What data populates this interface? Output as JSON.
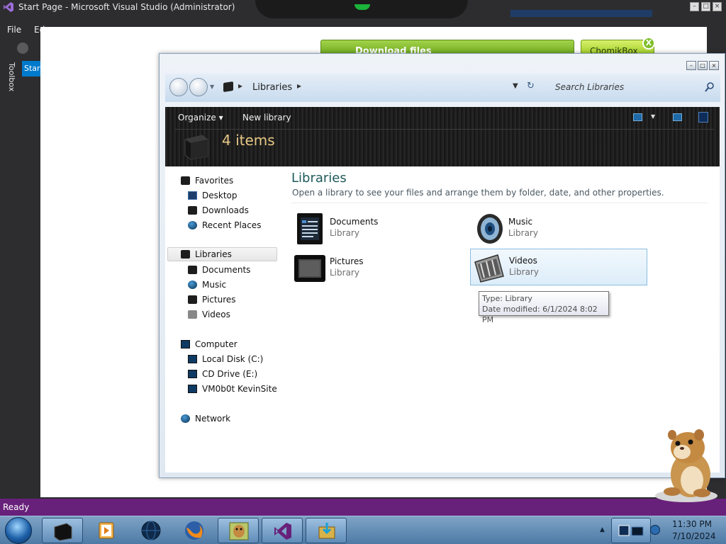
{
  "vs": {
    "title": "Start Page - Microsoft Visual Studio (Administrator)",
    "menu": {
      "file": "File",
      "edit": "Ed"
    },
    "toolbox_label": "Toolbox",
    "start_tab": "Start",
    "status": "Ready",
    "accent_color": "#68217a"
  },
  "ad": {
    "download_label": "Download files",
    "brand_label": "ChomikBox",
    "close_label": "X"
  },
  "explorer": {
    "address": {
      "location": "Libraries",
      "search_placeholder": "Search Libraries"
    },
    "toolbar": {
      "organize": "Organize",
      "new_library": "New library",
      "item_count": "4 items"
    },
    "nav": {
      "favorites": {
        "label": "Favorites",
        "items": [
          "Desktop",
          "Downloads",
          "Recent Places"
        ]
      },
      "libraries": {
        "label": "Libraries",
        "items": [
          "Documents",
          "Music",
          "Pictures",
          "Videos"
        ]
      },
      "computer": {
        "label": "Computer",
        "items": [
          "Local Disk (C:)",
          "CD Drive (E:)",
          "VM0b0t KevinSite"
        ]
      },
      "network": {
        "label": "Network"
      }
    },
    "content": {
      "heading": "Libraries",
      "description": "Open a library to see your files and arrange them by folder, date, and other properties.",
      "libraries": [
        {
          "name": "Documents",
          "type": "Library",
          "icon": "documents-icon"
        },
        {
          "name": "Music",
          "type": "Library",
          "icon": "music-icon"
        },
        {
          "name": "Pictures",
          "type": "Library",
          "icon": "pictures-icon"
        },
        {
          "name": "Videos",
          "type": "Library",
          "icon": "videos-icon"
        }
      ]
    },
    "tooltip": {
      "type_line": "Type: Library",
      "date_line": "Date modified: 6/1/2024 8:02 PM"
    }
  },
  "taskbar": {
    "apps": [
      "libraries-explorer",
      "media-player",
      "network-globe",
      "firefox",
      "chomikbox",
      "visual-studio",
      "download-manager"
    ],
    "clock": {
      "time": "11:30 PM",
      "date": "7/10/2024"
    }
  }
}
